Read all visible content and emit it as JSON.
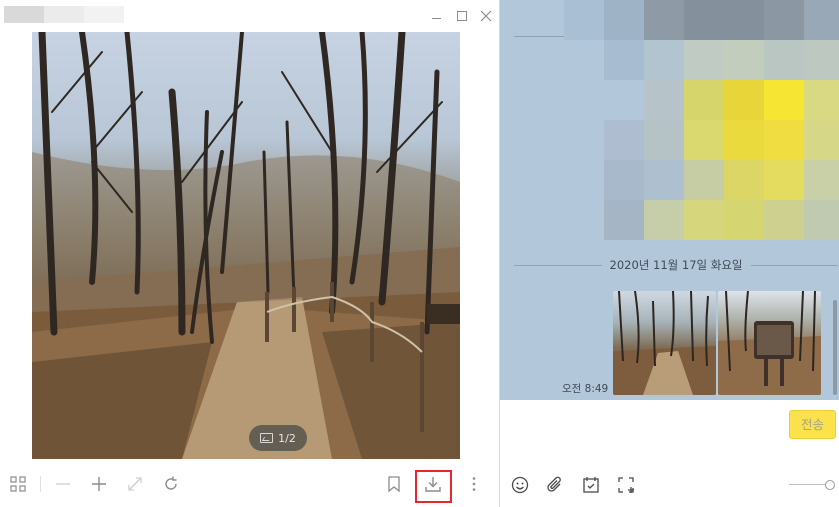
{
  "viewer": {
    "page_counter": "1/2",
    "toolbar_icons": [
      "grid-icon",
      "zoom-out-icon",
      "zoom-in-icon",
      "fit-icon",
      "rotate-icon",
      "bookmark-icon",
      "download-icon",
      "more-icon"
    ],
    "highlight_color": "#e8262b"
  },
  "chat": {
    "date_separator": "2020년 11월 17일 화요일",
    "message_time": "오전 8:49",
    "send_label": "전송",
    "background_color": "#b2c7da",
    "send_color": "#fbe24a",
    "input_icons": [
      "emoji-icon",
      "attach-icon",
      "calendar-icon",
      "capture-icon"
    ]
  }
}
